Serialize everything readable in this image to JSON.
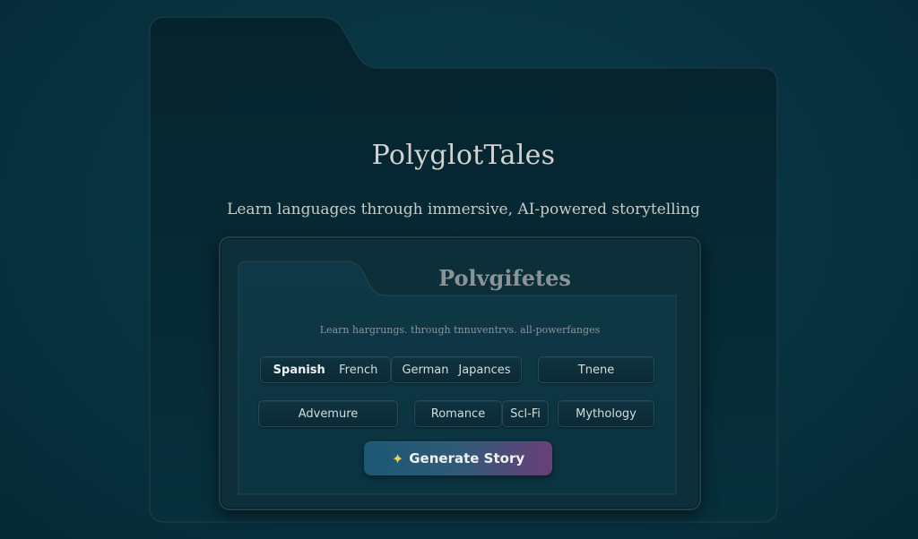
{
  "app": {
    "title": "PolyglotTales",
    "subtitle": "Learn languages through immersive, AI-powered storytelling"
  },
  "card": {
    "title": "Polvgifetes",
    "subtitle": "Learn hargrungs. through tnnuventrvs. all-powerfanges"
  },
  "languages": [
    "Spanish",
    "French",
    "German",
    "Japances"
  ],
  "selected_language": "Spanish",
  "theme_field": "Tnene",
  "genres": [
    "Advemure",
    "Romance",
    "Scl-Fi",
    "Mythology"
  ],
  "generate_button": {
    "icon": "sparkle-icon",
    "icon_glyph": "✦",
    "label": "Generate Story"
  },
  "colors": {
    "background": "#083240",
    "panel": "#062530",
    "button_start": "#1a5874",
    "button_end": "#6a3f78",
    "sparkle": "#f2cd5c"
  }
}
